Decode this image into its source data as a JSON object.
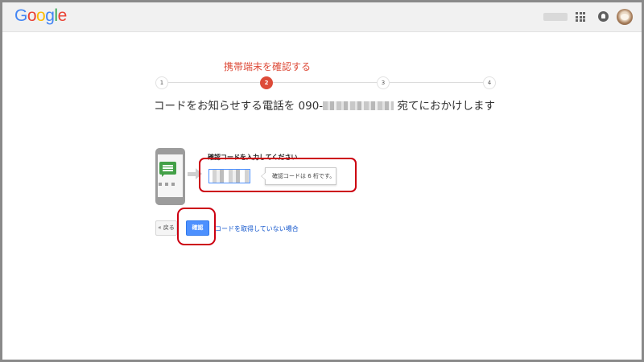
{
  "header": {
    "logo_letters": [
      {
        "char": "G",
        "color": "#4285f4"
      },
      {
        "char": "o",
        "color": "#ea4335"
      },
      {
        "char": "o",
        "color": "#fbbc05"
      },
      {
        "char": "g",
        "color": "#4285f4"
      },
      {
        "char": "l",
        "color": "#34a853"
      },
      {
        "char": "e",
        "color": "#ea4335"
      }
    ],
    "icons": [
      "apps-grid-icon",
      "notifications-bell-icon",
      "account-avatar"
    ]
  },
  "wizard": {
    "title": "携帯端末を確認する",
    "current_step": 2,
    "steps": [
      "1",
      "2",
      "3",
      "4"
    ]
  },
  "headline": {
    "prefix": "コードをお知らせする電話を 090-",
    "suffix": " 宛てにおかけします"
  },
  "code_entry": {
    "label": "確認コードを入力してください",
    "hint": "確認コードは 6 桁です。"
  },
  "actions": {
    "back_label": "« 戻る",
    "confirm_label": "確認",
    "no_code_link": "コードを取得していない場合"
  },
  "colors": {
    "accent_red": "#dd4b39",
    "primary_blue": "#4d90fe",
    "link_blue": "#1155cc",
    "highlight_red": "#cc0010"
  }
}
